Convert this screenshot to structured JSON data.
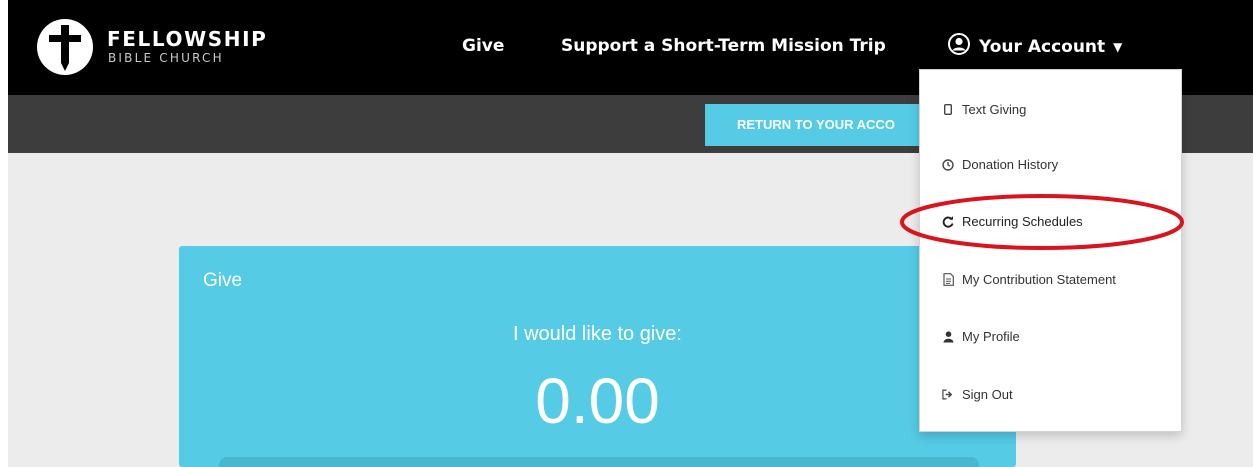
{
  "brand": {
    "title": "FELLOWSHIP",
    "subtitle": "BIBLE CHURCH"
  },
  "nav": {
    "give": "Give",
    "mission": "Support a Short-Term Mission Trip",
    "account": "Your Account"
  },
  "subbar": {
    "return_button": "RETURN TO YOUR ACCO"
  },
  "give_card": {
    "title": "Give",
    "prompt": "I would like to give:",
    "amount": "0.00"
  },
  "account_menu": {
    "items": [
      {
        "label": "Text Giving",
        "icon": "mobile-phone-icon"
      },
      {
        "label": "Donation History",
        "icon": "clock-icon"
      },
      {
        "label": "Recurring Schedules",
        "icon": "refresh-icon"
      },
      {
        "label": "My Contribution Statement",
        "icon": "document-icon"
      },
      {
        "label": "My Profile",
        "icon": "user-icon"
      },
      {
        "label": "Sign Out",
        "icon": "sign-out-icon"
      }
    ]
  },
  "colors": {
    "topbar": "#000000",
    "subbar": "#3d3d3d",
    "accent": "#55cbe6",
    "highlight": "#d9141c",
    "content_bg": "#ececec"
  }
}
